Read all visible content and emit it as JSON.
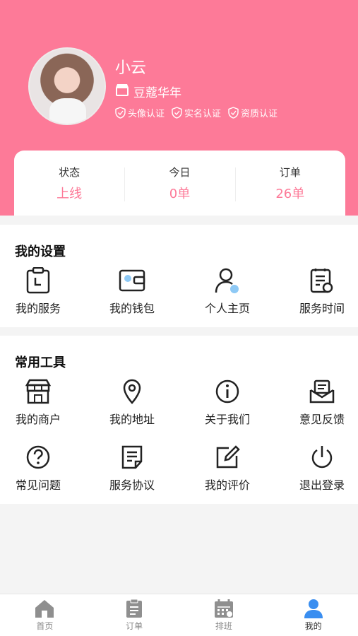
{
  "profile": {
    "name": "小云",
    "shop": "豆蔻华年",
    "verifications": [
      "头像认证",
      "实名认证",
      "资质认证"
    ]
  },
  "stats": [
    {
      "label": "状态",
      "value": "上线"
    },
    {
      "label": "今日",
      "value": "0单"
    },
    {
      "label": "订单",
      "value": "26单"
    }
  ],
  "settings": {
    "title": "我的设置",
    "items": [
      {
        "label": "我的服务",
        "icon": "clipboard-clock-icon"
      },
      {
        "label": "我的钱包",
        "icon": "wallet-icon"
      },
      {
        "label": "个人主页",
        "icon": "person-icon"
      },
      {
        "label": "服务时间",
        "icon": "schedule-list-icon"
      }
    ]
  },
  "tools": {
    "title": "常用工具",
    "items": [
      {
        "label": "我的商户",
        "icon": "storefront-icon"
      },
      {
        "label": "我的地址",
        "icon": "location-pin-icon"
      },
      {
        "label": "关于我们",
        "icon": "info-icon"
      },
      {
        "label": "意见反馈",
        "icon": "feedback-mail-icon"
      },
      {
        "label": "常见问题",
        "icon": "question-icon"
      },
      {
        "label": "服务协议",
        "icon": "document-icon"
      },
      {
        "label": "我的评价",
        "icon": "edit-icon"
      },
      {
        "label": "退出登录",
        "icon": "power-icon"
      }
    ]
  },
  "tabbar": [
    {
      "label": "首页",
      "icon": "home-icon"
    },
    {
      "label": "订单",
      "icon": "order-icon"
    },
    {
      "label": "排班",
      "icon": "calendar-icon"
    },
    {
      "label": "我的",
      "icon": "user-icon"
    }
  ],
  "colors": {
    "brand": "#fd7a98",
    "accent_blue": "#8ec9f5",
    "tab_active": "#3a8ef0",
    "tab_inactive": "#8f8f8f"
  }
}
